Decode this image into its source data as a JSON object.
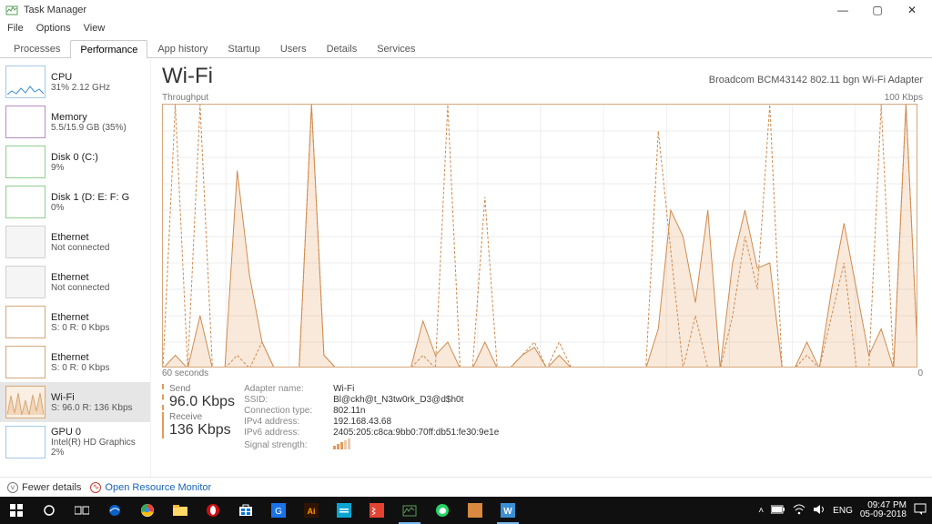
{
  "window": {
    "title": "Task Manager",
    "menu": [
      "File",
      "Options",
      "View"
    ],
    "controls": {
      "min": "—",
      "max": "▢",
      "close": "✕"
    }
  },
  "tabs": [
    {
      "label": "Processes"
    },
    {
      "label": "Performance",
      "active": true
    },
    {
      "label": "App history"
    },
    {
      "label": "Startup"
    },
    {
      "label": "Users"
    },
    {
      "label": "Details"
    },
    {
      "label": "Services"
    }
  ],
  "sidebar": [
    {
      "name": "CPU",
      "detail": "31% 2.12 GHz",
      "kind": "cpu"
    },
    {
      "name": "Memory",
      "detail": "5.5/15.9 GB (35%)",
      "kind": "mem"
    },
    {
      "name": "Disk 0 (C:)",
      "detail": "9%",
      "kind": "disk"
    },
    {
      "name": "Disk 1 (D: E: F: G",
      "detail": "0%",
      "kind": "disk"
    },
    {
      "name": "Ethernet",
      "detail": "Not connected",
      "kind": "eth-off"
    },
    {
      "name": "Ethernet",
      "detail": "Not connected",
      "kind": "eth-off"
    },
    {
      "name": "Ethernet",
      "detail": "S: 0 R: 0 Kbps",
      "kind": "eth"
    },
    {
      "name": "Ethernet",
      "detail": "S: 0 R: 0 Kbps",
      "kind": "eth"
    },
    {
      "name": "Wi-Fi",
      "detail": "S: 96.0 R: 136 Kbps",
      "kind": "wifi",
      "selected": true
    },
    {
      "name": "GPU 0",
      "detail": "Intel(R) HD Graphics",
      "extra": "2%",
      "kind": "gpu"
    }
  ],
  "main": {
    "title": "Wi-Fi",
    "adapter": "Broadcom BCM43142 802.11 bgn Wi-Fi Adapter",
    "chart_label_left": "Throughput",
    "chart_label_right": "100 Kbps",
    "chart_bottom_left": "60 seconds",
    "chart_bottom_right": "0",
    "send_label": "Send",
    "send_value": "96.0 Kbps",
    "recv_label": "Receive",
    "recv_value": "136 Kbps",
    "details": [
      {
        "k": "Adapter name:",
        "v": "Wi-Fi"
      },
      {
        "k": "SSID:",
        "v": "Bl@ckh@t_N3tw0rk_D3@d$h0t"
      },
      {
        "k": "Connection type:",
        "v": "802.11n"
      },
      {
        "k": "IPv4 address:",
        "v": "192.168.43.68"
      },
      {
        "k": "IPv6 address:",
        "v": "2405:205:c8ca:9bb0:70ff:db51:fe30:9e1e"
      },
      {
        "k": "Signal strength:",
        "v": ""
      }
    ]
  },
  "bottom": {
    "fewer": "Fewer details",
    "orm": "Open Resource Monitor"
  },
  "taskbar": {
    "lang": "ENG",
    "time": "09:47 PM",
    "date": "05-09-2018"
  },
  "chart_data": {
    "type": "line",
    "title": "Throughput",
    "xlabel": "60 seconds → 0",
    "ylabel": "Kbps",
    "ylim": [
      0,
      100
    ],
    "x_seconds": 60,
    "series": [
      {
        "name": "Send",
        "style": "dashed",
        "values": [
          0,
          100,
          0,
          100,
          0,
          0,
          5,
          0,
          10,
          0,
          0,
          0,
          100,
          5,
          0,
          0,
          0,
          0,
          0,
          0,
          0,
          5,
          0,
          100,
          0,
          0,
          65,
          0,
          0,
          5,
          10,
          0,
          10,
          0,
          0,
          0,
          0,
          0,
          0,
          0,
          90,
          45,
          0,
          20,
          0,
          0,
          20,
          50,
          30,
          100,
          0,
          0,
          5,
          0,
          20,
          40,
          0,
          0,
          100,
          0,
          100,
          0
        ]
      },
      {
        "name": "Receive",
        "style": "solid_fill",
        "values": [
          0,
          5,
          0,
          20,
          0,
          0,
          75,
          35,
          10,
          0,
          0,
          0,
          100,
          5,
          0,
          0,
          0,
          0,
          0,
          0,
          0,
          18,
          5,
          10,
          0,
          0,
          10,
          0,
          0,
          5,
          8,
          0,
          5,
          0,
          0,
          0,
          0,
          0,
          0,
          0,
          15,
          60,
          50,
          25,
          60,
          0,
          40,
          60,
          38,
          40,
          0,
          0,
          10,
          0,
          30,
          55,
          30,
          5,
          15,
          0,
          100,
          0
        ]
      }
    ]
  }
}
